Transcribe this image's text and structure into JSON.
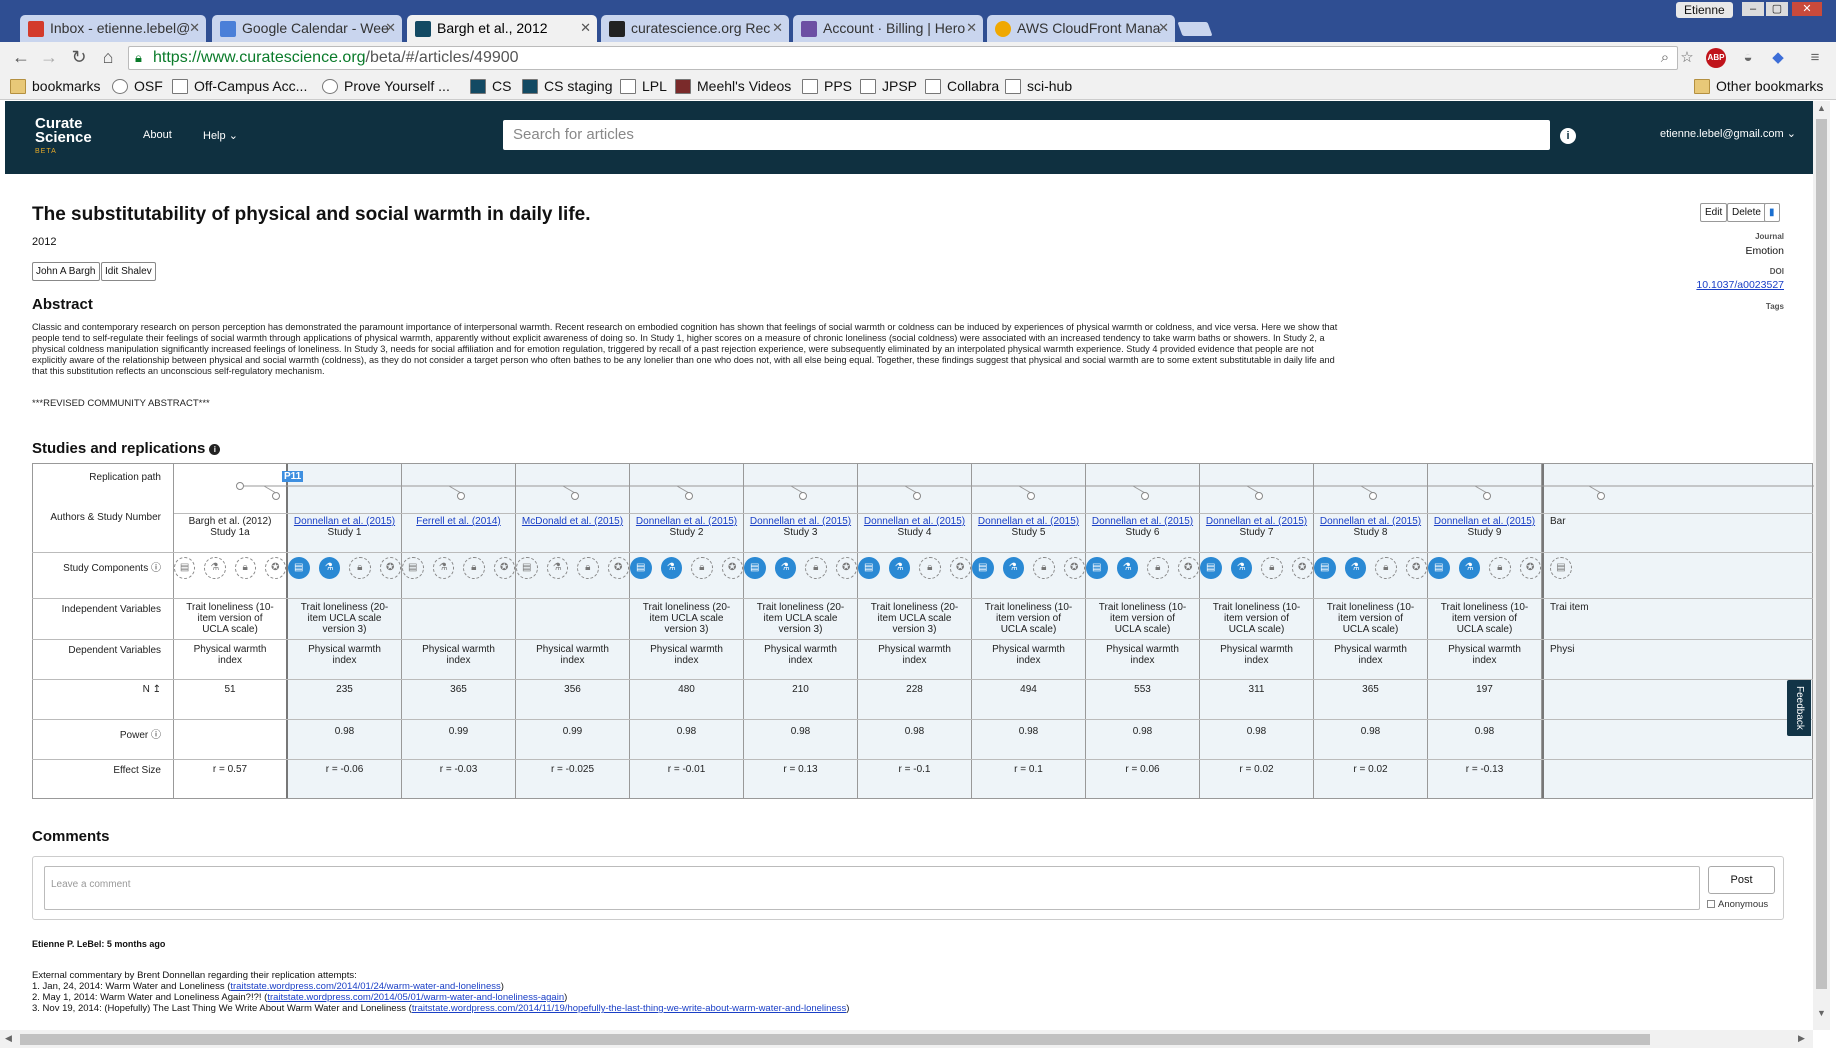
{
  "browser": {
    "tabs": [
      {
        "label": "Inbox - etienne.lebel@",
        "icon_color": "#d33b2c",
        "active": false
      },
      {
        "label": "Google Calendar - Wee",
        "icon_color": "#4a7fd8",
        "active": false
      },
      {
        "label": "Bargh et al., 2012",
        "icon_color": "#134a63",
        "active": true
      },
      {
        "label": "curatescience.org Rec",
        "icon_color": "#222222",
        "active": false
      },
      {
        "label": "Account · Billing | Hero",
        "icon_color": "#6c4fa3",
        "active": false
      },
      {
        "label": "AWS CloudFront Mana",
        "icon_color": "#f0a800",
        "active": false
      }
    ],
    "window_user": "Etienne",
    "url_host": "https://www.curatescience.org",
    "url_path": "/beta/#/articles/49900",
    "bookmarks": [
      "bookmarks",
      "OSF",
      "Off-Campus Acc...",
      "Prove Yourself ...",
      "CS",
      "CS staging",
      "LPL",
      "Meehl's Videos",
      "PPS",
      "JPSP",
      "Collabra",
      "sci-hub"
    ],
    "other_bookmarks": "Other bookmarks"
  },
  "site": {
    "logo_line1": "Curate",
    "logo_line2": "Science",
    "logo_beta": "BETA",
    "nav_about": "About",
    "nav_help": "Help",
    "search_placeholder": "Search for articles",
    "user_email": "etienne.lebel@gmail.com"
  },
  "article": {
    "title": "The substitutability of physical and social warmth in daily life.",
    "year": "2012",
    "authors": [
      "John A Bargh",
      "Idit Shalev"
    ],
    "abstract_heading": "Abstract",
    "abstract": "Classic and contemporary research on person perception has demonstrated the paramount importance of interpersonal warmth. Recent research on embodied cognition has shown that feelings of social warmth or coldness can be induced by experiences of physical warmth or coldness, and vice versa. Here we show that people tend to self-regulate their feelings of social warmth through applications of physical warmth, apparently without explicit awareness of doing so. In Study 1, higher scores on a measure of chronic loneliness (social coldness) were associated with an increased tendency to take warm baths or showers. In Study 2, a physical coldness manipulation significantly increased feelings of loneliness. In Study 3, needs for social affiliation and for emotion regulation, triggered by recall of a past rejection experience, were subsequently eliminated by an interpolated physical warmth experience. Study 4 provided evidence that people are not explicitly aware of the relationship between physical and social warmth (coldness), as they do not consider a target person who often bathes to be any lonelier than one who does not, with all else being equal. Together, these findings suggest that physical and social warmth are to some extent substitutable in daily life and that this substitution reflects an unconscious self-regulatory mechanism.",
    "revised": "***REVISED COMMUNITY ABSTRACT***",
    "edit_label": "Edit",
    "delete_label": "Delete",
    "journal_label": "Journal",
    "journal": "Emotion",
    "doi_label": "DOI",
    "doi": "10.1037/a0023527",
    "tags_label": "Tags"
  },
  "studies": {
    "heading": "Studies and replications",
    "path_badge": "P11",
    "row_labels": {
      "path": "Replication path",
      "authors": "Authors & Study Number",
      "components": "Study Components",
      "iv": "Independent Variables",
      "dv": "Dependent Variables",
      "n": "N",
      "power": "Power",
      "effect": "Effect Size"
    },
    "columns": [
      {
        "author": "Bargh et al. (2012)",
        "study": "Study 1a",
        "iv": "Trait loneliness (10-item version of UCLA scale)",
        "dv": "Physical warmth index",
        "n": "51",
        "power": "",
        "effect": "r = 0.57",
        "original": true
      },
      {
        "author": "Donnellan et al. (2015)",
        "study": "Study 1",
        "iv": "Trait loneliness (20-item UCLA scale version 3)",
        "dv": "Physical warmth index",
        "n": "235",
        "power": "0.98",
        "effect": "r = -0.06"
      },
      {
        "author": "Ferrell et al. (2014)",
        "study": "",
        "iv": "",
        "dv": "Physical warmth index",
        "n": "365",
        "power": "0.99",
        "effect": "r = -0.03"
      },
      {
        "author": "McDonald et al. (2015)",
        "study": "",
        "iv": "",
        "dv": "Physical warmth index",
        "n": "356",
        "power": "0.99",
        "effect": "r = -0.025"
      },
      {
        "author": "Donnellan et al. (2015)",
        "study": "Study 2",
        "iv": "Trait loneliness (20-item UCLA scale version 3)",
        "dv": "Physical warmth index",
        "n": "480",
        "power": "0.98",
        "effect": "r = -0.01"
      },
      {
        "author": "Donnellan et al. (2015)",
        "study": "Study 3",
        "iv": "Trait loneliness (20-item UCLA scale version 3)",
        "dv": "Physical warmth index",
        "n": "210",
        "power": "0.98",
        "effect": "r = 0.13"
      },
      {
        "author": "Donnellan et al. (2015)",
        "study": "Study 4",
        "iv": "Trait loneliness (20-item UCLA scale version 3)",
        "dv": "Physical warmth index",
        "n": "228",
        "power": "0.98",
        "effect": "r = -0.1"
      },
      {
        "author": "Donnellan et al. (2015)",
        "study": "Study 5",
        "iv": "Trait loneliness (10-item version of UCLA scale)",
        "dv": "Physical warmth index",
        "n": "494",
        "power": "0.98",
        "effect": "r = 0.1"
      },
      {
        "author": "Donnellan et al. (2015)",
        "study": "Study 6",
        "iv": "Trait loneliness (10-item version of UCLA scale)",
        "dv": "Physical warmth index",
        "n": "553",
        "power": "0.98",
        "effect": "r = 0.06"
      },
      {
        "author": "Donnellan et al. (2015)",
        "study": "Study 7",
        "iv": "Trait loneliness (10-item version of UCLA scale)",
        "dv": "Physical warmth index",
        "n": "311",
        "power": "0.98",
        "effect": "r = 0.02"
      },
      {
        "author": "Donnellan et al. (2015)",
        "study": "Study 8",
        "iv": "Trait loneliness (10-item version of UCLA scale)",
        "dv": "Physical warmth index",
        "n": "365",
        "power": "0.98",
        "effect": "r = 0.02"
      },
      {
        "author": "Donnellan et al. (2015)",
        "study": "Study 9",
        "iv": "Trait loneliness (10-item version of UCLA scale)",
        "dv": "Physical warmth index",
        "n": "197",
        "power": "0.98",
        "effect": "r = -0.13"
      }
    ],
    "partial_column": {
      "author": "Bar",
      "iv": "Trai item",
      "dv": "Physi"
    }
  },
  "feedback": "Feedback",
  "comments": {
    "heading": "Comments",
    "placeholder": "Leave a comment",
    "post_label": "Post",
    "anonymous_label": "Anonymous",
    "author_line": "Etienne P. LeBel: 5 months ago",
    "intro": "External commentary by Brent Donnellan regarding their replication attempts:",
    "items": [
      {
        "text": "1. Jan, 24, 2014: Warm Water and Loneliness (",
        "link": "traitstate.wordpress.com/2014/01/24/warm-water-and-loneliness",
        "end": ")"
      },
      {
        "text": "2. May 1, 2014: Warm Water and Loneliness Again?!?! (",
        "link": "traitstate.wordpress.com/2014/05/01/warm-water-and-loneliness-again",
        "end": ")"
      },
      {
        "text": "3. Nov 19, 2014: (Hopefully) The Last Thing We Write About Warm Water and Loneliness (",
        "link": "traitstate.wordpress.com/2014/11/19/hopefully-the-last-thing-we-write-about-warm-water-and-loneliness",
        "end": ")"
      }
    ]
  }
}
